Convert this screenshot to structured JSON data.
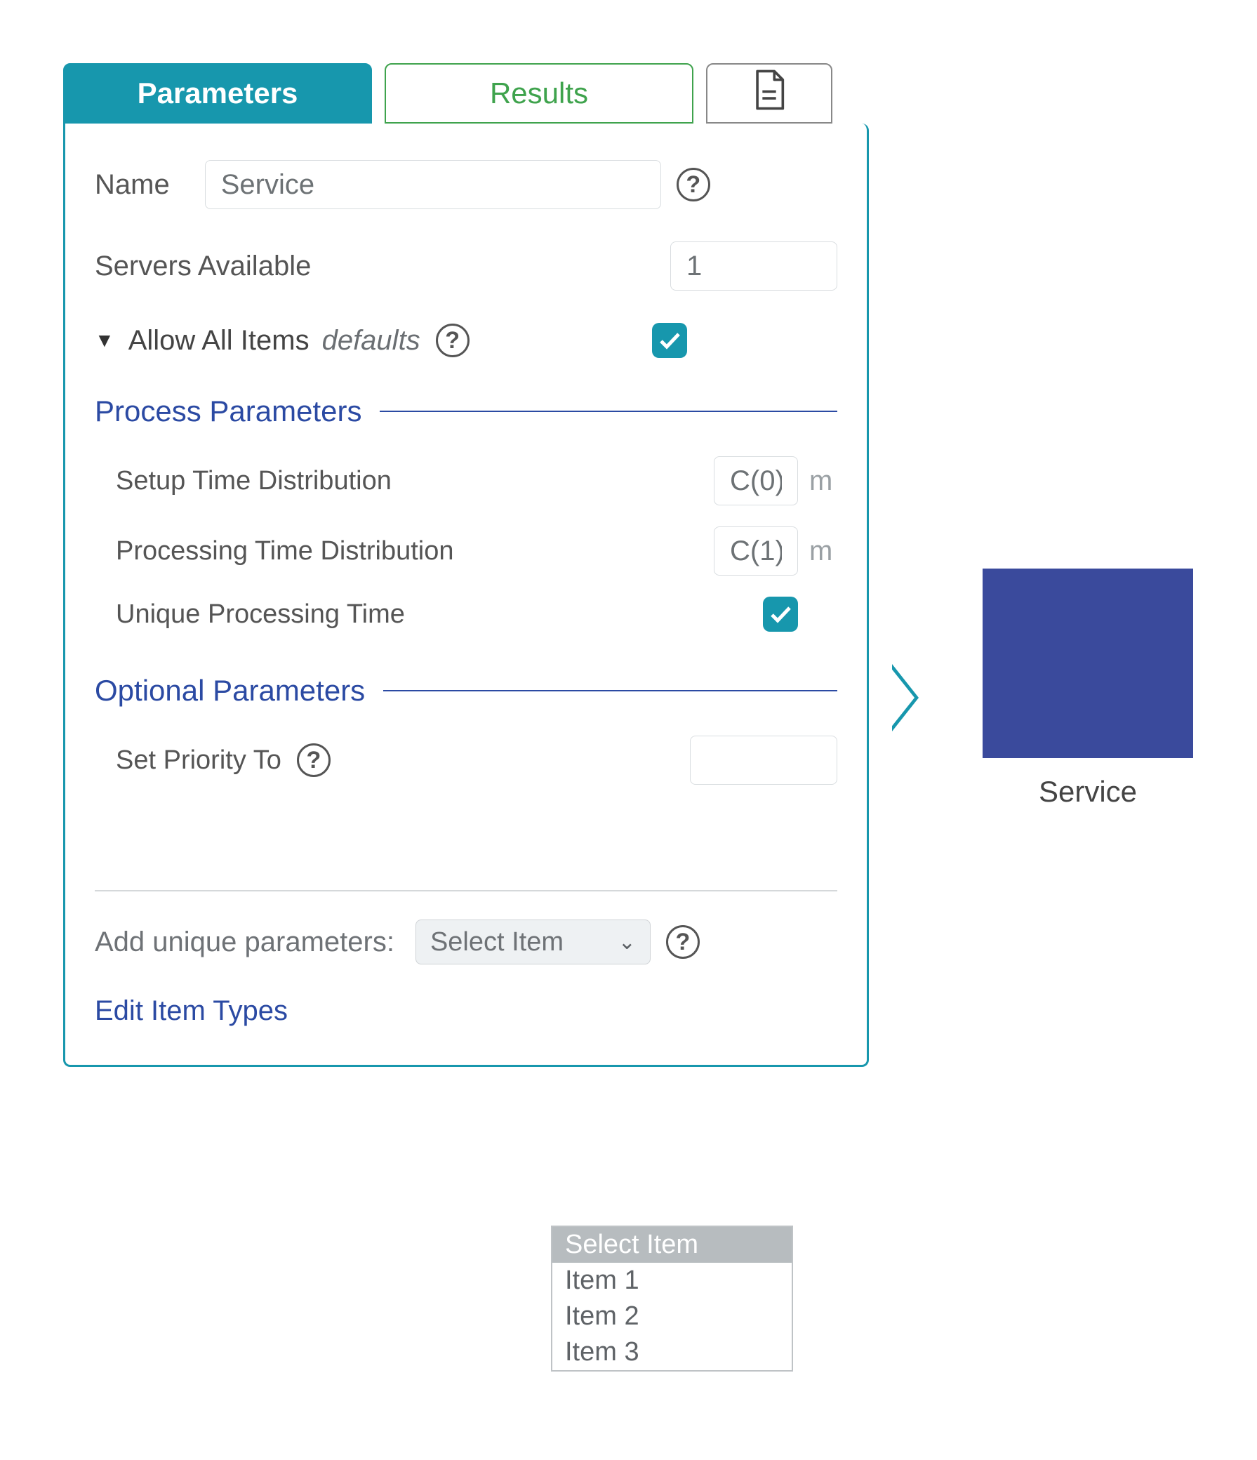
{
  "tabs": {
    "parameters": "Parameters",
    "results": "Results"
  },
  "fields": {
    "name_label": "Name",
    "name_value": "Service",
    "servers_label": "Servers Available",
    "servers_value": "1",
    "allow_all_label": "Allow All Items",
    "defaults_text": "defaults"
  },
  "sections": {
    "process": "Process Parameters",
    "optional": "Optional Parameters"
  },
  "process": {
    "setup_label": "Setup Time Distribution",
    "setup_value": "C(0)",
    "proc_label": "Processing Time Distribution",
    "proc_value": "C(1)",
    "unique_label": "Unique Processing Time",
    "unit": "m"
  },
  "optional": {
    "priority_label": "Set Priority To",
    "priority_value": ""
  },
  "footer": {
    "add_unique_label": "Add unique parameters:",
    "select_placeholder": "Select Item",
    "edit_link": "Edit Item Types"
  },
  "dropdown_options": [
    "Select Item",
    "Item 1",
    "Item 2",
    "Item 3"
  ],
  "node": {
    "caption": "Service"
  }
}
